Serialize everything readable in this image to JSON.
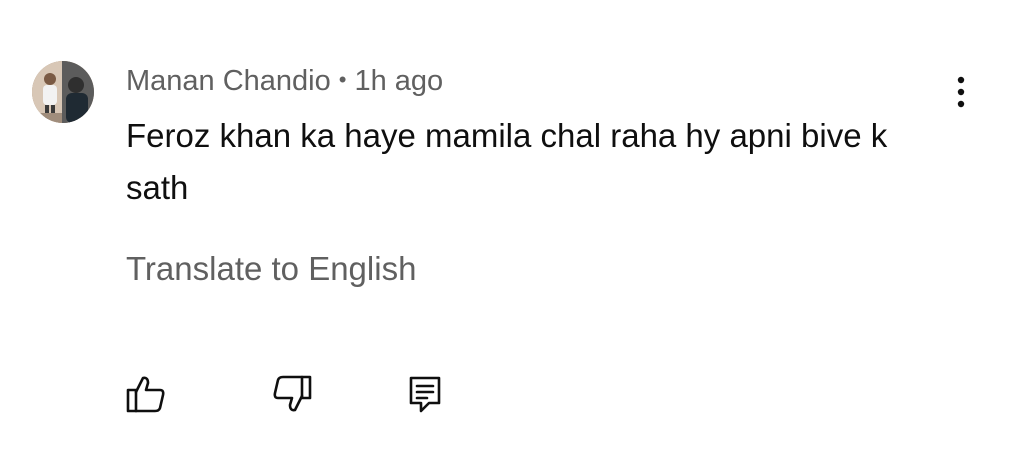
{
  "comment": {
    "author": "Manan Chandio",
    "separator": "•",
    "time": "1h ago",
    "text": "Feroz khan ka haye mamila chal raha hy apni bive k sath",
    "translate_label": "Translate to English"
  },
  "icons": {
    "avatar": "avatar",
    "more": "more-vert-icon",
    "like": "thumb-up-icon",
    "dislike": "thumb-down-icon",
    "reply": "reply-icon"
  },
  "colors": {
    "background": "#ffffff",
    "primary_text": "#0f0f0f",
    "secondary_text": "#606060",
    "icon": "#0f0f0f"
  }
}
